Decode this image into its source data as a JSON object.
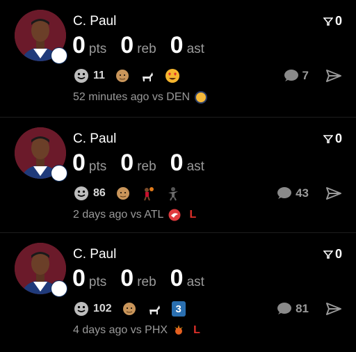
{
  "cards": [
    {
      "name": "C. Paul",
      "filter_count": "0",
      "stats": [
        {
          "value": "0",
          "unit": "pts"
        },
        {
          "value": "0",
          "unit": "reb"
        },
        {
          "value": "0",
          "unit": "ast"
        }
      ],
      "reaction_count": "11",
      "comment_count": "7",
      "time": "52 minutes ago vs DEN",
      "result": ""
    },
    {
      "name": "C. Paul",
      "filter_count": "0",
      "stats": [
        {
          "value": "0",
          "unit": "pts"
        },
        {
          "value": "0",
          "unit": "reb"
        },
        {
          "value": "0",
          "unit": "ast"
        }
      ],
      "reaction_count": "86",
      "comment_count": "43",
      "time": "2 days ago vs ATL",
      "result": "L"
    },
    {
      "name": "C. Paul",
      "filter_count": "0",
      "stats": [
        {
          "value": "0",
          "unit": "pts"
        },
        {
          "value": "0",
          "unit": "reb"
        },
        {
          "value": "0",
          "unit": "ast"
        }
      ],
      "reaction_count": "102",
      "comment_count": "81",
      "time": "4 days ago vs PHX",
      "result": "L",
      "number_badge": "3"
    }
  ],
  "colors": {
    "background": "#000000",
    "loss": "#e0302a",
    "muted": "#9a9a9a"
  }
}
